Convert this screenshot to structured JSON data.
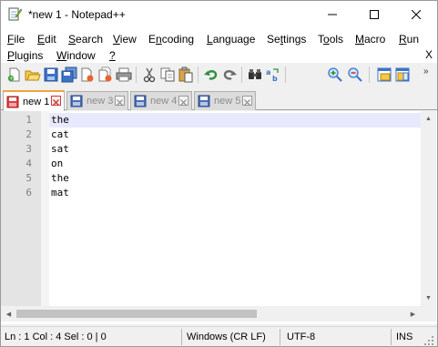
{
  "window": {
    "title": "*new 1 - Notepad++",
    "app_icon": "notepad-icon",
    "controls": [
      "minimize-icon",
      "maximize-icon",
      "close-icon"
    ]
  },
  "menu": {
    "row1": [
      {
        "id": "file",
        "label": "File",
        "key": "F",
        "rest": "ile"
      },
      {
        "id": "edit",
        "label": "Edit",
        "key": "E",
        "rest": "dit"
      },
      {
        "id": "search",
        "label": "Search",
        "key": "S",
        "rest": "earch"
      },
      {
        "id": "view",
        "label": "View",
        "key": "V",
        "rest": "iew"
      },
      {
        "id": "encoding",
        "label": "Encoding",
        "key": "n",
        "pre": "E",
        "rest": "coding"
      },
      {
        "id": "language",
        "label": "Language",
        "key": "L",
        "rest": "anguage"
      },
      {
        "id": "settings",
        "label": "Settings",
        "key": "t",
        "pre": "Se",
        "rest": "tings"
      },
      {
        "id": "tools",
        "label": "Tools",
        "key": "o",
        "pre": "T",
        "rest": "ols"
      },
      {
        "id": "macro",
        "label": "Macro",
        "key": "M",
        "rest": "acro"
      },
      {
        "id": "run",
        "label": "Run",
        "key": "R",
        "rest": "un"
      }
    ],
    "row2": [
      {
        "id": "plugins",
        "label": "Plugins",
        "key": "P",
        "rest": "lugins"
      },
      {
        "id": "window",
        "label": "Window",
        "key": "W",
        "rest": "indow"
      },
      {
        "id": "help",
        "label": "?",
        "key": "?",
        "rest": ""
      }
    ],
    "close_doc": "X"
  },
  "toolbar": {
    "buttons": [
      "new-file-icon",
      "open-file-icon",
      "save-icon",
      "save-all-icon",
      "close-icon",
      "close-all-icon",
      "print-icon",
      "cut-icon",
      "copy-icon",
      "paste-icon",
      "undo-icon",
      "redo-icon",
      "find-icon",
      "replace-icon",
      "zoom-in-icon",
      "zoom-out-icon",
      "sync-vertical-icon",
      "sync-horizontal-icon"
    ],
    "more": "»"
  },
  "tabs": [
    {
      "label": "new 1",
      "active": true
    },
    {
      "label": "new 3",
      "active": false
    },
    {
      "label": "new 4",
      "active": false
    },
    {
      "label": "new 5",
      "active": false
    }
  ],
  "editor": {
    "line_numbers": [
      "1",
      "2",
      "3",
      "4",
      "5",
      "6"
    ],
    "lines": [
      "the",
      "cat",
      "sat",
      "on",
      "the",
      "mat"
    ]
  },
  "status": {
    "position": "Ln : 1    Col : 4    Sel : 0 | 0",
    "eol": "Windows (CR LF)",
    "encoding": "UTF-8",
    "mode": "INS"
  },
  "colors": {
    "caret_line": "#e8e8ff",
    "active_tab_accent": "#f3a33b",
    "gutter": "#e4e4e4"
  }
}
